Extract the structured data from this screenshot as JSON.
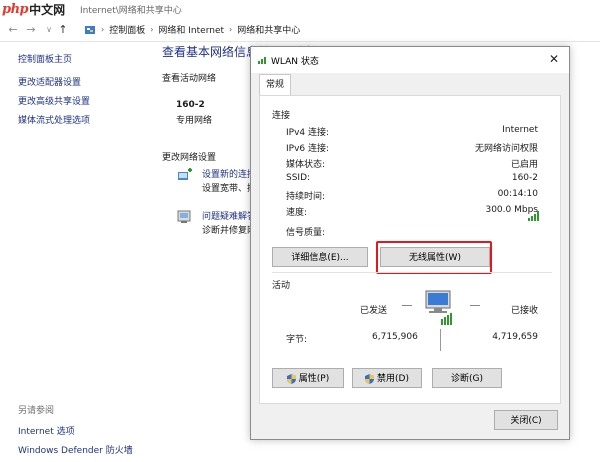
{
  "brand": {
    "mark": "php",
    "name": "中文网"
  },
  "window": {
    "title": "Internet\\网络和共享中心"
  },
  "nav": {
    "back": "←",
    "forward": "→",
    "up": "↑"
  },
  "breadcrumb": [
    "控制面板",
    "网络和 Internet",
    "网络和共享中心"
  ],
  "sidebar": {
    "items": [
      "控制面板主页",
      "更改适配器设置",
      "更改高级共享设置",
      "媒体流式处理选项"
    ],
    "see_also": "另请参阅",
    "bottom_items": [
      "Internet 选项",
      "Windows Defender 防火墙"
    ]
  },
  "main": {
    "title": "查看基本网络信息并设置连接",
    "active_networks": "查看活动网络",
    "network_name": "160-2",
    "network_type": "专用网络",
    "change_settings": "更改网络设置",
    "tasks": [
      {
        "link": "设置新的连接或网络",
        "desc": "设置宽带、拨号或 VPN 连接；或设置路由器或接入点。"
      },
      {
        "link": "问题疑难解答",
        "desc": "诊断并修复网络问题，或者获得疑难解答信息。"
      }
    ]
  },
  "dialog": {
    "title": "WLAN 状态",
    "close": "✕",
    "tab": "常规",
    "connection_label": "连接",
    "rows": [
      {
        "key": "IPv4 连接:",
        "value": "Internet"
      },
      {
        "key": "IPv6 连接:",
        "value": "无网络访问权限"
      },
      {
        "key": "媒体状态:",
        "value": "已启用"
      },
      {
        "key": "SSID:",
        "value": "160-2"
      },
      {
        "key": "持续时间:",
        "value": "00:14:10"
      },
      {
        "key": "速度:",
        "value": "300.0 Mbps"
      }
    ],
    "signal_label": "信号质量:",
    "details_button": "详细信息(E)...",
    "wireless_props_button": "无线属性(W)",
    "activity_label": "活动",
    "sent_label": "已发送",
    "received_label": "已接收",
    "bytes_label": "字节:",
    "bytes_sent": "6,715,906",
    "bytes_received": "4,719,659",
    "properties_button": "属性(P)",
    "disable_button": "禁用(D)",
    "diagnose_button": "诊断(G)",
    "close_button": "关闭(C)"
  },
  "colors": {
    "link": "#1e3287",
    "highlight": "#e5171d",
    "signal": "#2e9a2e"
  }
}
